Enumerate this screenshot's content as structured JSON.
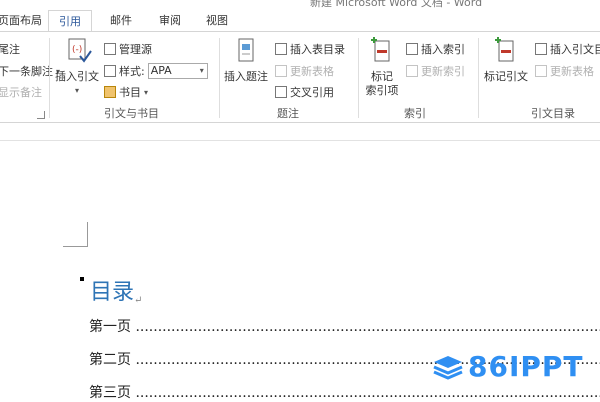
{
  "title_bar": {
    "title": "新建 Microsoft Word 文档 - Word"
  },
  "tabs": [
    {
      "label": "页面布局"
    },
    {
      "label": "引用"
    },
    {
      "label": "邮件"
    },
    {
      "label": "审阅"
    },
    {
      "label": "视图"
    }
  ],
  "ribbon": {
    "footnotes": {
      "insert_endnote": "尾注",
      "next_footnote": "下一条脚注",
      "show_notes": "显示备注"
    },
    "citations": {
      "insert_citation": "插入引文",
      "manage_sources": "管理源",
      "style_label": "样式:",
      "style_value": "APA",
      "bibliography": "书目",
      "group_label": "引文与书目"
    },
    "captions": {
      "insert_caption": "插入题注",
      "insert_table_of_figures": "插入表目录",
      "update_table": "更新表格",
      "cross_reference": "交叉引用",
      "group_label": "题注"
    },
    "index": {
      "mark_entry_line1": "标记",
      "mark_entry_line2": "索引项",
      "insert_index": "插入索引",
      "update_index": "更新索引",
      "group_label": "索引"
    },
    "table_of_authorities": {
      "mark_citation": "标记引文",
      "insert_toa": "插入引文目录",
      "update_table": "更新表格",
      "group_label": "引文目录"
    }
  },
  "document": {
    "toc_title": "目录",
    "toc_entries": [
      {
        "text": "第一页 ..............................................................................................................."
      },
      {
        "text": "第二页 ..............................................................................................................."
      },
      {
        "text": "第三页 ..............................................................................................................."
      }
    ]
  },
  "watermark": {
    "text": "86IPPT"
  },
  "colors": {
    "accent": "#2b579a",
    "heading": "#2e74b5",
    "watermark": "#2f8ff2"
  }
}
